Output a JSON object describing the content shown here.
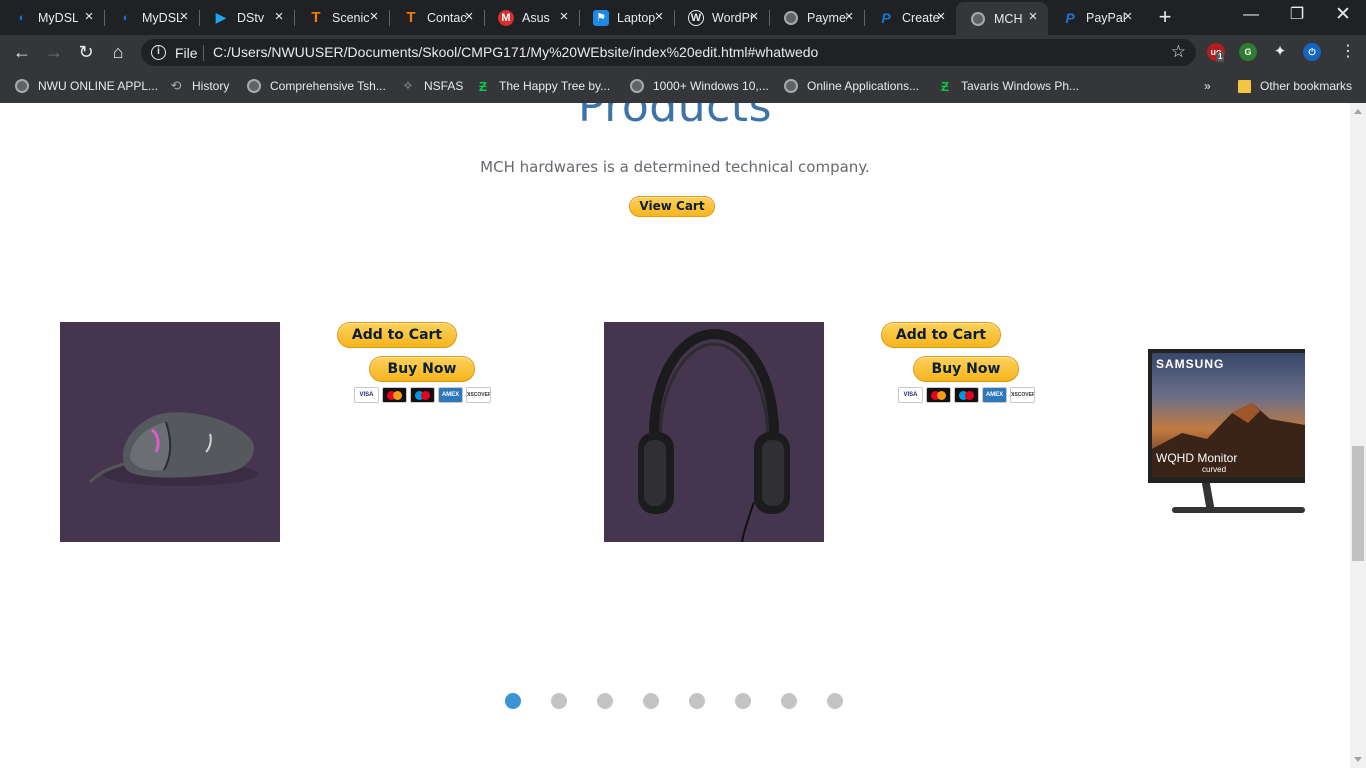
{
  "browser": {
    "tabs": [
      {
        "title": "MyDSL",
        "icon": "myds-icon",
        "active": false
      },
      {
        "title": "MyDSL",
        "icon": "myds-icon",
        "active": false
      },
      {
        "title": "DStv",
        "icon": "dstv-play-icon",
        "active": false
      },
      {
        "title": "Scenic",
        "icon": "t-orange-icon",
        "active": false
      },
      {
        "title": "Contact",
        "icon": "t-orange-icon",
        "active": false
      },
      {
        "title": "Asus",
        "icon": "m-red-icon",
        "active": false
      },
      {
        "title": "Laptop",
        "icon": "flag-blue-icon",
        "active": false
      },
      {
        "title": "WordPress",
        "icon": "wordpress-icon",
        "active": false
      },
      {
        "title": "Payment",
        "icon": "globe-icon",
        "active": false
      },
      {
        "title": "Create",
        "icon": "paypal-icon",
        "active": false
      },
      {
        "title": "MCH",
        "icon": "globe-icon",
        "active": true
      },
      {
        "title": "PayPal",
        "icon": "paypal-icon",
        "active": false
      }
    ],
    "new_tab_label": "+",
    "address": {
      "scheme": "File",
      "url": "C:/Users/NWUUSER/Documents/Skool/CMPG171/My%20WEbsite/index%20edit.html#whatwedo"
    },
    "extension_badge": "1",
    "bookmarks": [
      {
        "label": "NWU ONLINE APPL...",
        "icon": "globe-icon"
      },
      {
        "label": "History",
        "icon": "history-icon"
      },
      {
        "label": "Comprehensive Tsh...",
        "icon": "globe-icon"
      },
      {
        "label": "NSFAS",
        "icon": "nsfas-icon"
      },
      {
        "label": "The Happy Tree by...",
        "icon": "deviantart-icon"
      },
      {
        "label": "1000+ Windows 10,...",
        "icon": "globe-icon"
      },
      {
        "label": "Online Applications...",
        "icon": "globe-icon"
      },
      {
        "label": "Tavaris Windows Ph...",
        "icon": "deviantart-icon"
      }
    ],
    "overflow_label": "»",
    "other_bookmarks": "Other bookmarks"
  },
  "page": {
    "section_title": "Products",
    "tagline": "MCH hardwares is a determined technical company.",
    "view_cart_label": "View Cart",
    "products": [
      {
        "name": "mouse",
        "add_to_cart": "Add to Cart",
        "buy_now": "Buy Now"
      },
      {
        "name": "headphones",
        "add_to_cart": "Add to Cart",
        "buy_now": "Buy Now"
      },
      {
        "name": "monitor",
        "brand": "SAMSUNG",
        "caption": "WQHD Monitor",
        "subcaption": "curved"
      }
    ],
    "payment_cards": [
      "VISA",
      "MC",
      "MAESTRO",
      "AMEX",
      "DISCOVER"
    ],
    "carousel": {
      "total": 8,
      "active_index": 0
    }
  },
  "colors": {
    "title": "#3c73a8",
    "paypal_gold": "#ffc439",
    "product_bg": "#45354f",
    "dot_active": "#3a94d7",
    "dot_inactive": "#c4c4c4"
  }
}
